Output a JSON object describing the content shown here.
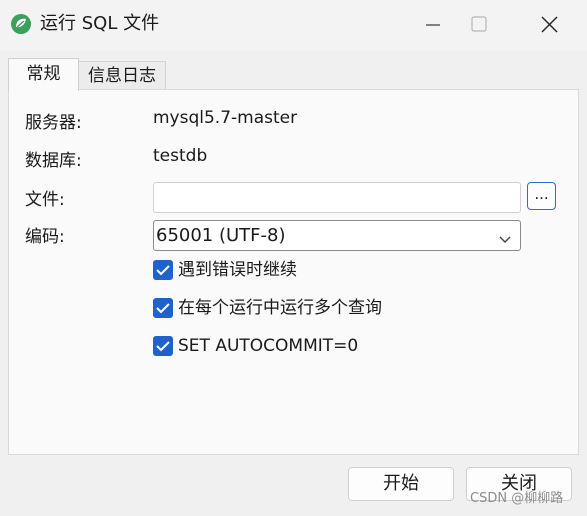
{
  "window": {
    "title": "运行 SQL 文件",
    "icon": "navicat-leaf-icon"
  },
  "tabs": [
    {
      "label": "常规",
      "active": true
    },
    {
      "label": "信息日志",
      "active": false
    }
  ],
  "form": {
    "server_label": "服务器:",
    "server_value": "mysql5.7-master",
    "database_label": "数据库:",
    "database_value": "testdb",
    "file_label": "文件:",
    "file_value": "",
    "browse_label": "...",
    "encoding_label": "编码:",
    "encoding_value": "65001 (UTF-8)"
  },
  "options": [
    {
      "label": "遇到错误时继续",
      "checked": true
    },
    {
      "label": "在每个运行中运行多个查询",
      "checked": true
    },
    {
      "label": "SET AUTOCOMMIT=0",
      "checked": true
    }
  ],
  "buttons": {
    "start": "开始",
    "close": "关闭"
  },
  "watermark": "CSDN @柳柳路",
  "colors": {
    "accent": "#1f62c9",
    "icon_green": "#3aa05a"
  }
}
